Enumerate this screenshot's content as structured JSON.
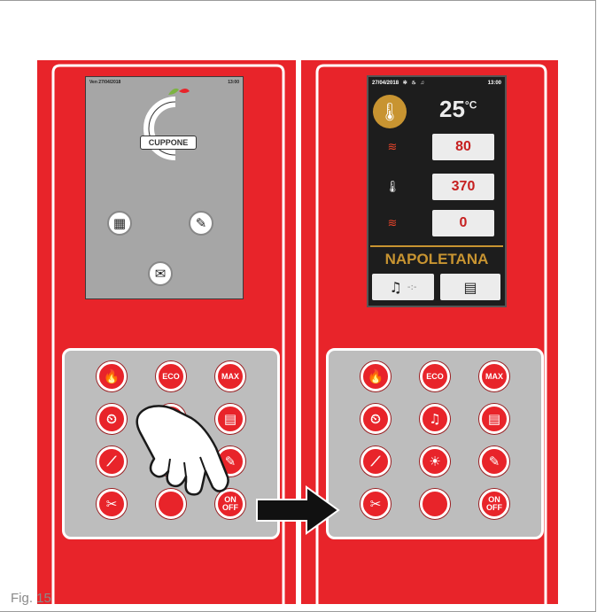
{
  "caption": "Fig. 15",
  "colors": {
    "panel_red": "#e8242a",
    "keypad_gray": "#bdbdbd",
    "screen_gray": "#a6a6a6",
    "screen_dark": "#1d1d1d",
    "accent_gold": "#c89431",
    "value_red": "#c62020"
  },
  "left_screen": {
    "date": "Ven 27/04/2018",
    "time": "13:00",
    "logo_text": "CUPPONE",
    "icons": [
      "calendar-clock-icon",
      "recipe-book-icon",
      "mail-icon"
    ]
  },
  "right_screen": {
    "date": "27/04/2018",
    "time": "13:00",
    "status_icons": [
      "fan-icon",
      "heating-icon",
      "bell-icon"
    ],
    "temperature": "25",
    "temperature_unit": "°C",
    "params": [
      {
        "icon": "top-heater-icon",
        "value": "80"
      },
      {
        "icon": "thermometer-icon",
        "value": "370"
      },
      {
        "icon": "bottom-heater-icon",
        "value": "0"
      }
    ],
    "program_name": "NAPOLETANA",
    "bottom_buttons": [
      {
        "icon": "bell-timer-icon",
        "label": "-:-"
      },
      {
        "icon": "document-icon",
        "label": ""
      }
    ]
  },
  "keypad_left": {
    "keys": [
      {
        "name": "flame-key",
        "glyph": "🔥",
        "text": ""
      },
      {
        "name": "eco-key",
        "glyph": "",
        "text": "ECO"
      },
      {
        "name": "max-key",
        "glyph": "",
        "text": "MAX"
      },
      {
        "name": "clock-key",
        "glyph": "⏲",
        "text": ""
      },
      {
        "name": "blank-key",
        "glyph": "",
        "text": ""
      },
      {
        "name": "document-key",
        "glyph": "▤",
        "text": ""
      },
      {
        "name": "steam-key",
        "glyph": "⟋",
        "text": ""
      },
      {
        "name": "blank-key",
        "glyph": "",
        "text": ""
      },
      {
        "name": "recipe-key",
        "glyph": "✎",
        "text": ""
      },
      {
        "name": "tools-key",
        "glyph": "✂",
        "text": ""
      },
      {
        "name": "blank-key",
        "glyph": "",
        "text": ""
      },
      {
        "name": "on-off-key",
        "glyph": "",
        "text": "ON\nOFF"
      }
    ]
  },
  "keypad_right": {
    "keys": [
      {
        "name": "flame-key",
        "glyph": "🔥",
        "text": ""
      },
      {
        "name": "eco-key",
        "glyph": "",
        "text": "ECO"
      },
      {
        "name": "max-key",
        "glyph": "",
        "text": "MAX"
      },
      {
        "name": "clock-key",
        "glyph": "⏲",
        "text": ""
      },
      {
        "name": "bell-key",
        "glyph": "♫",
        "text": ""
      },
      {
        "name": "document-key",
        "glyph": "▤",
        "text": ""
      },
      {
        "name": "steam-key",
        "glyph": "⟋",
        "text": ""
      },
      {
        "name": "light-key",
        "glyph": "☀",
        "text": ""
      },
      {
        "name": "recipe-key",
        "glyph": "✎",
        "text": ""
      },
      {
        "name": "tools-key",
        "glyph": "✂",
        "text": ""
      },
      {
        "name": "blank-key",
        "glyph": "",
        "text": ""
      },
      {
        "name": "on-off-key",
        "glyph": "",
        "text": "ON\nOFF"
      }
    ]
  }
}
